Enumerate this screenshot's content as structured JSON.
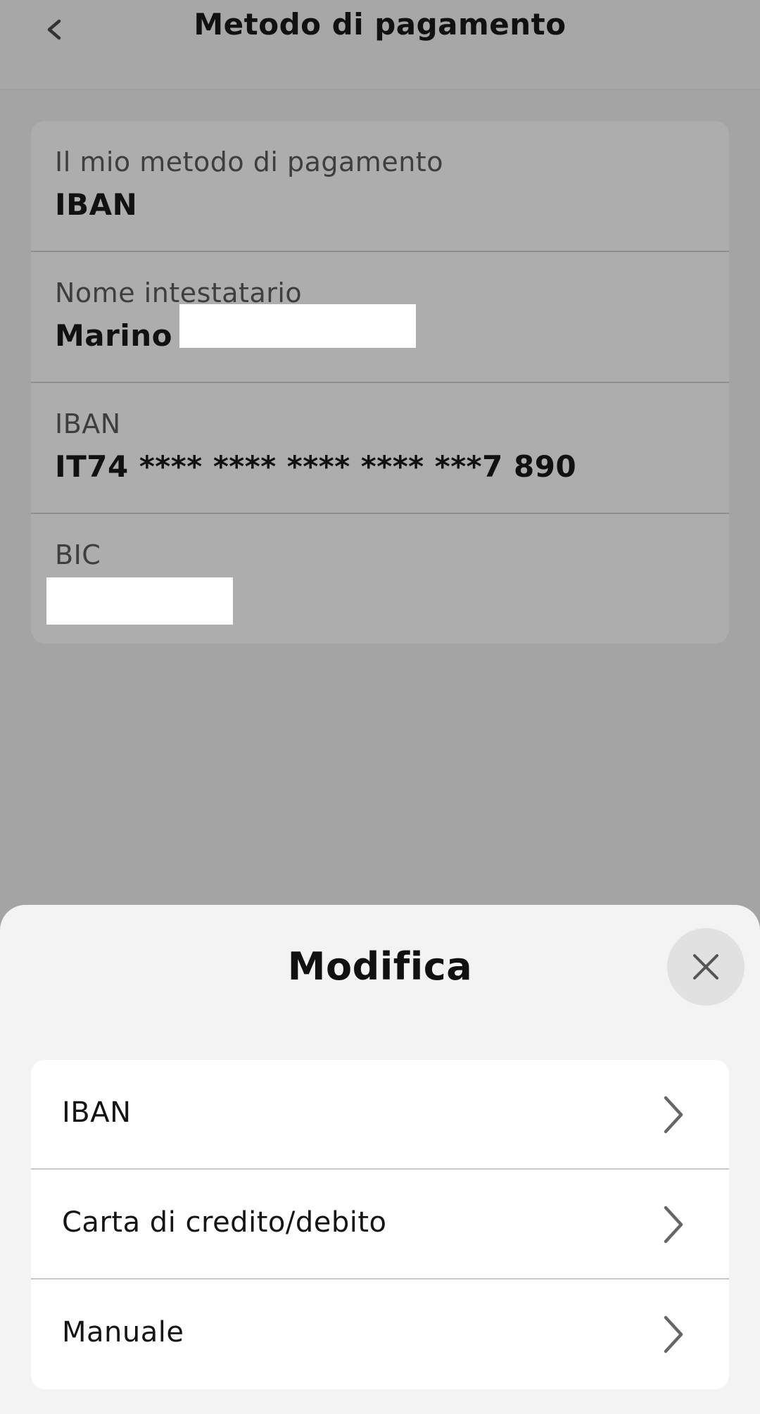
{
  "header": {
    "title": "Metodo di pagamento",
    "back_icon": "chevron-left-icon"
  },
  "card": {
    "rows": [
      {
        "label": "Il mio metodo di pagamento",
        "value": "IBAN"
      },
      {
        "label": "Nome intestatario",
        "value": "Marino"
      },
      {
        "label": "IBAN",
        "value": "IT74 **** **** **** **** ***7 890"
      },
      {
        "label": "BIC",
        "value": ""
      }
    ]
  },
  "sheet": {
    "title": "Modifica",
    "close_icon": "close-icon",
    "options": [
      {
        "label": "IBAN"
      },
      {
        "label": "Carta di credito/debito"
      },
      {
        "label": "Manuale"
      }
    ]
  },
  "colors": {
    "overlay_background": "#a4a4a4",
    "sheet_background": "#f3f3f3",
    "option_background": "#ffffff"
  }
}
